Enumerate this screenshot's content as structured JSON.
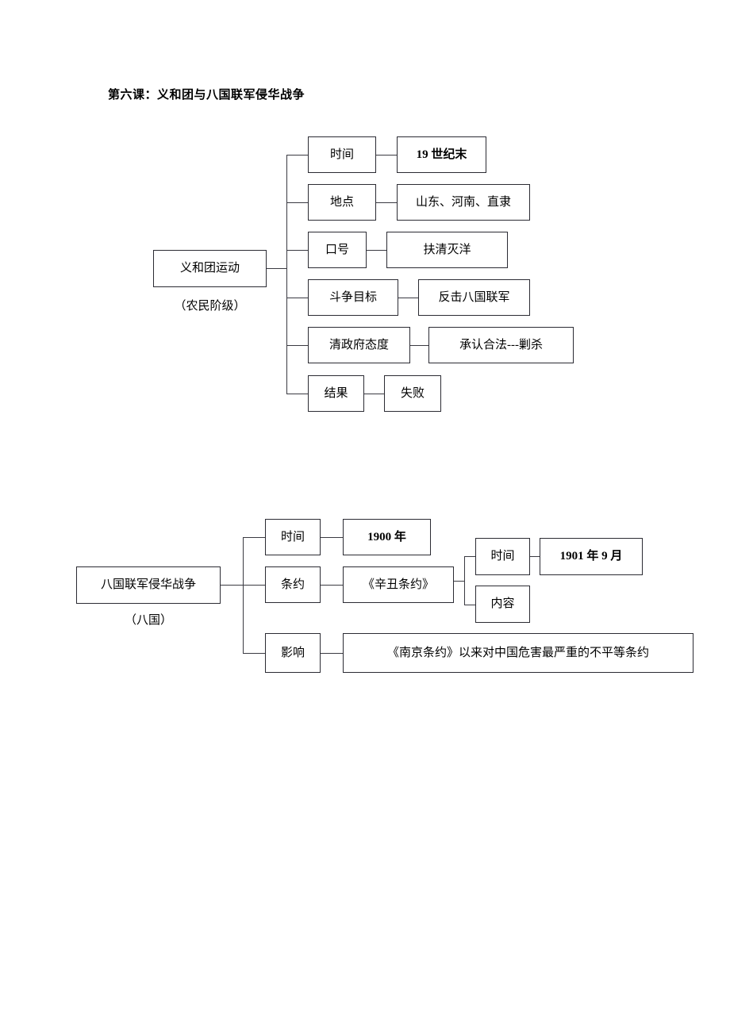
{
  "document": {
    "title": "第六课：义和团与八国联军侵华战争"
  },
  "diagram1": {
    "root": {
      "label": "义和团运动",
      "caption": "（农民阶级）"
    },
    "rows": [
      {
        "key": "时间",
        "value": "19 世纪末",
        "value_bold": true
      },
      {
        "key": "地点",
        "value": "山东、河南、直隶",
        "value_bold": false
      },
      {
        "key": "口号",
        "value": "扶清灭洋",
        "value_bold": false
      },
      {
        "key": "斗争目标",
        "value": "反击八国联军",
        "value_bold": false
      },
      {
        "key": "清政府态度",
        "value": "承认合法---剿杀",
        "value_bold": false
      },
      {
        "key": "结果",
        "value": "失败",
        "value_bold": false
      }
    ]
  },
  "diagram2": {
    "root": {
      "label": "八国联军侵华战争",
      "caption": "（八国）"
    },
    "rows": [
      {
        "key": "时间",
        "value": "1900 年",
        "value_bold": true
      },
      {
        "key": "条约",
        "value": "《辛丑条约》",
        "value_bold": false
      },
      {
        "key": "影响",
        "value": "《南京条约》以来对中国危害最严重的不平等条约",
        "value_bold": false
      }
    ],
    "treaty_detail": [
      {
        "key": "时间",
        "value": "1901 年 9 月",
        "value_bold": true
      },
      {
        "key": "内容",
        "value": "",
        "value_bold": false
      }
    ]
  }
}
